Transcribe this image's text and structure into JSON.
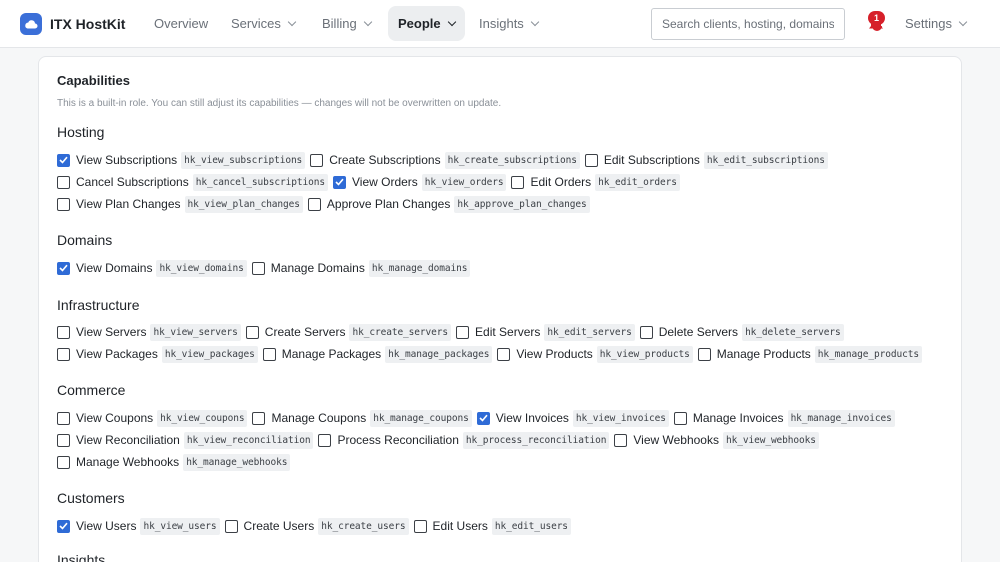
{
  "app": {
    "name": "ITX HostKit",
    "brand_color": "#3b6fd8"
  },
  "nav": {
    "overview": "Overview",
    "services": "Services",
    "billing": "Billing",
    "people": "People",
    "insights": "Insights",
    "settings": "Settings"
  },
  "search": {
    "placeholder": "Search clients, hosting, domains,"
  },
  "notifications": {
    "count": "1",
    "badge_color": "#d6202a"
  },
  "capabilities": {
    "title": "Capabilities",
    "note": "This is a built-in role. You can still adjust its capabilities — changes will not be overwritten on update.",
    "check_color": "#2f6bd6",
    "sections": [
      {
        "title": "Hosting",
        "rows": [
          [
            {
              "label": "View Subscriptions",
              "code": "hk_view_subscriptions",
              "checked": true
            },
            {
              "label": "Create Subscriptions",
              "code": "hk_create_subscriptions",
              "checked": false
            },
            {
              "label": "Edit Subscriptions",
              "code": "hk_edit_subscriptions",
              "checked": false
            }
          ],
          [
            {
              "label": "Cancel Subscriptions",
              "code": "hk_cancel_subscriptions",
              "checked": false
            },
            {
              "label": "View Orders",
              "code": "hk_view_orders",
              "checked": true
            },
            {
              "label": "Edit Orders",
              "code": "hk_edit_orders",
              "checked": false
            }
          ],
          [
            {
              "label": "View Plan Changes",
              "code": "hk_view_plan_changes",
              "checked": false
            },
            {
              "label": "Approve Plan Changes",
              "code": "hk_approve_plan_changes",
              "checked": false
            }
          ]
        ]
      },
      {
        "title": "Domains",
        "rows": [
          [
            {
              "label": "View Domains",
              "code": "hk_view_domains",
              "checked": true
            },
            {
              "label": "Manage Domains",
              "code": "hk_manage_domains",
              "checked": false
            }
          ]
        ]
      },
      {
        "title": "Infrastructure",
        "rows": [
          [
            {
              "label": "View Servers",
              "code": "hk_view_servers",
              "checked": false
            },
            {
              "label": "Create Servers",
              "code": "hk_create_servers",
              "checked": false
            },
            {
              "label": "Edit Servers",
              "code": "hk_edit_servers",
              "checked": false
            },
            {
              "label": "Delete Servers",
              "code": "hk_delete_servers",
              "checked": false
            }
          ],
          [
            {
              "label": "View Packages",
              "code": "hk_view_packages",
              "checked": false
            },
            {
              "label": "Manage Packages",
              "code": "hk_manage_packages",
              "checked": false
            },
            {
              "label": "View Products",
              "code": "hk_view_products",
              "checked": false
            },
            {
              "label": "Manage Products",
              "code": "hk_manage_products",
              "checked": false
            }
          ]
        ]
      },
      {
        "title": "Commerce",
        "rows": [
          [
            {
              "label": "View Coupons",
              "code": "hk_view_coupons",
              "checked": false
            },
            {
              "label": "Manage Coupons",
              "code": "hk_manage_coupons",
              "checked": false
            },
            {
              "label": "View Invoices",
              "code": "hk_view_invoices",
              "checked": true
            },
            {
              "label": "Manage Invoices",
              "code": "hk_manage_invoices",
              "checked": false
            }
          ],
          [
            {
              "label": "View Reconciliation",
              "code": "hk_view_reconciliation",
              "checked": false
            },
            {
              "label": "Process Reconciliation",
              "code": "hk_process_reconciliation",
              "checked": false
            },
            {
              "label": "View Webhooks",
              "code": "hk_view_webhooks",
              "checked": false
            }
          ],
          [
            {
              "label": "Manage Webhooks",
              "code": "hk_manage_webhooks",
              "checked": false
            }
          ]
        ]
      },
      {
        "title": "Customers",
        "rows": [
          [
            {
              "label": "View Users",
              "code": "hk_view_users",
              "checked": true
            },
            {
              "label": "Create Users",
              "code": "hk_create_users",
              "checked": false
            },
            {
              "label": "Edit Users",
              "code": "hk_edit_users",
              "checked": false
            }
          ]
        ]
      },
      {
        "title": "Insights",
        "rows": []
      }
    ]
  }
}
